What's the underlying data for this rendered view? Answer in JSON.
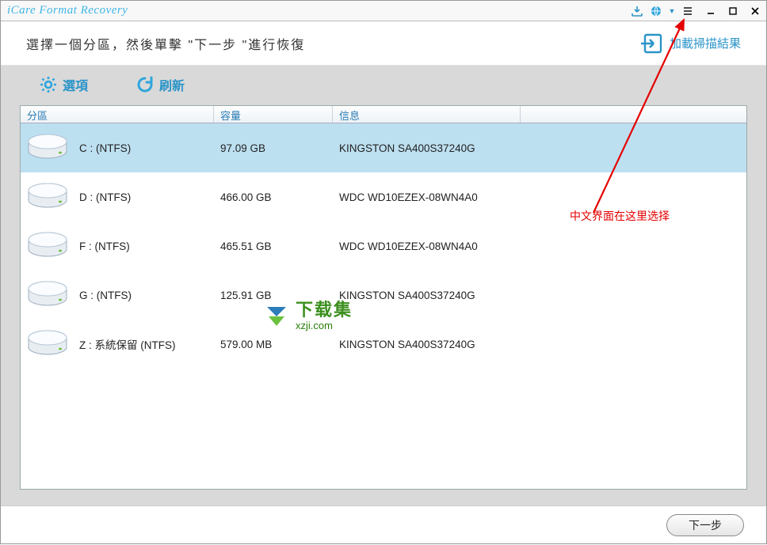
{
  "app": {
    "title": "iCare Format Recovery"
  },
  "titlebar_icons": {
    "download": "download-icon",
    "globe": "globe-icon",
    "menu": "menu-icon",
    "minimize": "minimize-button",
    "maximize": "maximize-button",
    "close": "close-button"
  },
  "instruction": "選擇一個分區，然後單擊 \"下一步 \"進行恢復",
  "load_result_label": "加載掃描結果",
  "tools": {
    "options": "選項",
    "refresh": "刷新"
  },
  "columns": {
    "partition": "分區",
    "size": "容量",
    "info": "信息"
  },
  "partitions": [
    {
      "label": "C :   (NTFS)",
      "size": "97.09 GB",
      "info": "KINGSTON SA400S37240G",
      "selected": true
    },
    {
      "label": "D :   (NTFS)",
      "size": "466.00 GB",
      "info": "WDC WD10EZEX-08WN4A0",
      "selected": false
    },
    {
      "label": "F :   (NTFS)",
      "size": "465.51 GB",
      "info": "WDC WD10EZEX-08WN4A0",
      "selected": false
    },
    {
      "label": "G :   (NTFS)",
      "size": "125.91 GB",
      "info": "KINGSTON SA400S37240G",
      "selected": false
    },
    {
      "label": "Z : 系統保留 (NTFS)",
      "size": "579.00 MB",
      "info": "KINGSTON SA400S37240G",
      "selected": false
    }
  ],
  "next_button": "下一步",
  "annotation_text": "中文界面在这里选择",
  "watermark": {
    "line1": "下载集",
    "line2": "xzji.com"
  }
}
